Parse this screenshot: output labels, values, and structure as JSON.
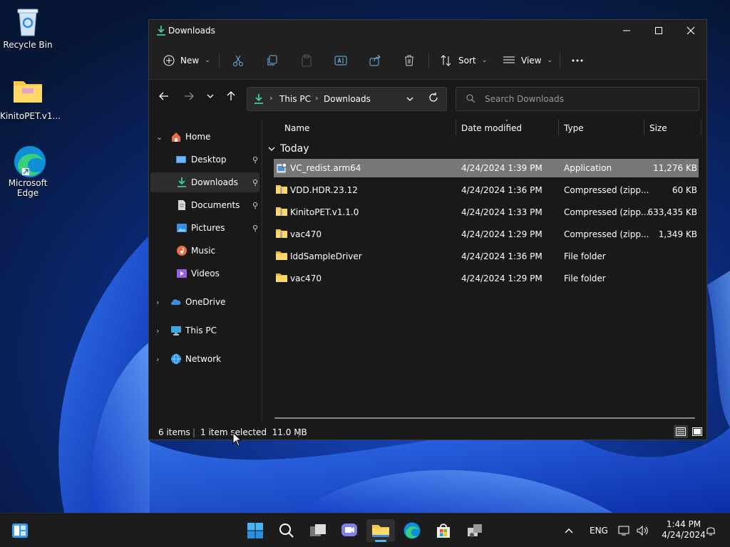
{
  "desktop": {
    "icons": [
      {
        "label": "Recycle Bin"
      },
      {
        "label": "KinitoPET.v1..."
      },
      {
        "label": "Microsoft Edge"
      }
    ]
  },
  "window": {
    "title": "Downloads",
    "toolbar": {
      "new_label": "New",
      "sort_label": "Sort",
      "view_label": "View"
    },
    "address": {
      "crumbs": [
        "This PC",
        "Downloads"
      ]
    },
    "search": {
      "placeholder": "Search Downloads"
    },
    "sidebar": {
      "items": [
        {
          "label": "Home"
        },
        {
          "label": "Desktop"
        },
        {
          "label": "Downloads"
        },
        {
          "label": "Documents"
        },
        {
          "label": "Pictures"
        },
        {
          "label": "Music"
        },
        {
          "label": "Videos"
        },
        {
          "label": "OneDrive"
        },
        {
          "label": "This PC"
        },
        {
          "label": "Network"
        }
      ]
    },
    "columns": [
      "Name",
      "Date modified",
      "Type",
      "Size"
    ],
    "group_label": "Today",
    "files": [
      {
        "name": "VC_redist.arm64",
        "date": "4/24/2024 1:39 PM",
        "type": "Application",
        "size": "11,276 KB",
        "icon": "application-icon"
      },
      {
        "name": "VDD.HDR.23.12",
        "date": "4/24/2024 1:36 PM",
        "type": "Compressed (zipp...",
        "size": "60 KB",
        "icon": "zip-folder-icon"
      },
      {
        "name": "KinitoPET.v1.1.0",
        "date": "4/24/2024 1:33 PM",
        "type": "Compressed (zipp...",
        "size": "633,435 KB",
        "icon": "zip-folder-icon"
      },
      {
        "name": "vac470",
        "date": "4/24/2024 1:29 PM",
        "type": "Compressed (zipp...",
        "size": "1,349 KB",
        "icon": "zip-folder-icon"
      },
      {
        "name": "IddSampleDriver",
        "date": "4/24/2024 1:36 PM",
        "type": "File folder",
        "size": "",
        "icon": "folder-icon"
      },
      {
        "name": "vac470",
        "date": "4/24/2024 1:29 PM",
        "type": "File folder",
        "size": "",
        "icon": "folder-icon"
      }
    ],
    "status": {
      "count": "6 items",
      "selection": "1 item selected  11.0 MB"
    }
  },
  "taskbar": {
    "lang": "ENG",
    "time": "1:44 PM",
    "date": "4/24/2024"
  },
  "colors": {
    "accent": "#5cb4f2",
    "selection": "#777777",
    "folder": "#f4c84a"
  }
}
